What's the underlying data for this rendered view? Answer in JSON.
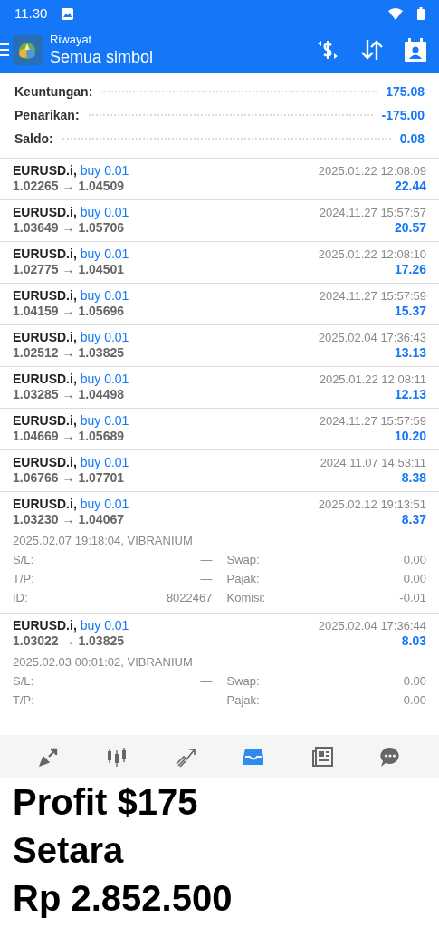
{
  "status_bar": {
    "time": "11.30"
  },
  "app_bar": {
    "subtitle": "Riwayat",
    "title": "Semua simbol"
  },
  "summary": [
    {
      "label": "Keuntungan:",
      "value": "175.08"
    },
    {
      "label": "Penarikan:",
      "value": "-175.00"
    },
    {
      "label": "Saldo:",
      "value": "0.08"
    }
  ],
  "deals": [
    {
      "symbol": "EURUSD.i,",
      "side": "buy 0.01",
      "prices": "1.02265 → 1.04509",
      "time": "2025.01.22 12:08:09",
      "profit": "22.44"
    },
    {
      "symbol": "EURUSD.i,",
      "side": "buy 0.01",
      "prices": "1.03649 → 1.05706",
      "time": "2024.11.27 15:57:57",
      "profit": "20.57"
    },
    {
      "symbol": "EURUSD.i,",
      "side": "buy 0.01",
      "prices": "1.02775 → 1.04501",
      "time": "2025.01.22 12:08:10",
      "profit": "17.26"
    },
    {
      "symbol": "EURUSD.i,",
      "side": "buy 0.01",
      "prices": "1.04159 → 1.05696",
      "time": "2024.11.27 15:57:59",
      "profit": "15.37"
    },
    {
      "symbol": "EURUSD.i,",
      "side": "buy 0.01",
      "prices": "1.02512 → 1.03825",
      "time": "2025.02.04 17:36:43",
      "profit": "13.13"
    },
    {
      "symbol": "EURUSD.i,",
      "side": "buy 0.01",
      "prices": "1.03285 → 1.04498",
      "time": "2025.01.22 12:08:11",
      "profit": "12.13"
    },
    {
      "symbol": "EURUSD.i,",
      "side": "buy 0.01",
      "prices": "1.04669 → 1.05689",
      "time": "2024.11.27 15:57:59",
      "profit": "10.20"
    },
    {
      "symbol": "EURUSD.i,",
      "side": "buy 0.01",
      "prices": "1.06766 → 1.07701",
      "time": "2024.11.07 14:53:11",
      "profit": "8.38"
    },
    {
      "symbol": "EURUSD.i,",
      "side": "buy 0.01",
      "prices": "1.03230 → 1.04067",
      "time": "2025.02.12 19:13:51",
      "profit": "8.37",
      "opened": "2025.02.07 19:18:04, VIBRANIUM",
      "fields": [
        {
          "label": "S/L:",
          "value": "—"
        },
        {
          "label": "Swap:",
          "value": "0.00"
        },
        {
          "label": "T/P:",
          "value": "—"
        },
        {
          "label": "Pajak:",
          "value": "0.00"
        },
        {
          "label": "ID:",
          "value": "8022467"
        },
        {
          "label": "Komisi:",
          "value": "-0.01"
        }
      ]
    },
    {
      "symbol": "EURUSD.i,",
      "side": "buy 0.01",
      "prices": "1.03022 → 1.03825",
      "time": "2025.02.04 17:36:44",
      "profit": "8.03",
      "opened": "2025.02.03 00:01:02, VIBRANIUM",
      "fields": [
        {
          "label": "S/L:",
          "value": "—"
        },
        {
          "label": "Swap:",
          "value": "0.00"
        },
        {
          "label": "T/P:",
          "value": "—"
        },
        {
          "label": "Pajak:",
          "value": "0.00"
        }
      ]
    }
  ],
  "bottom_nav": [
    {
      "kind": "trade",
      "selected": false
    },
    {
      "kind": "chart",
      "selected": false
    },
    {
      "kind": "trend",
      "selected": false
    },
    {
      "kind": "history",
      "selected": true
    },
    {
      "kind": "news",
      "selected": false
    },
    {
      "kind": "chat",
      "selected": false
    }
  ],
  "caption": [
    "Profit $175",
    "Setara",
    "Rp 2.852.500"
  ]
}
